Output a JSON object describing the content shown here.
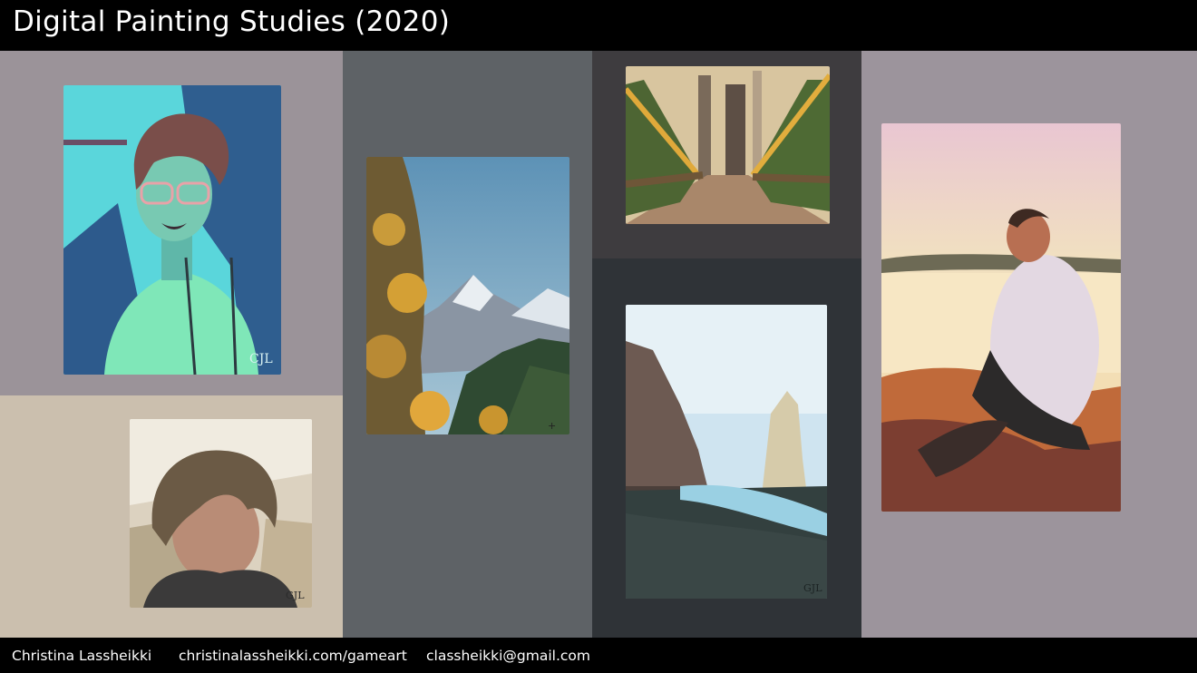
{
  "header": {
    "title": "Digital Painting Studies (2020)"
  },
  "footer": {
    "name": "Christina Lassheikki",
    "website": "christinalassheikki.com/gameart",
    "email": "classheikki@gmail.com"
  },
  "colors": {
    "panel_mauve": "#9b9399",
    "panel_beige": "#cbbfae",
    "panel_slate": "#5e6266",
    "panel_dark_gray": "#3e3c3f",
    "panel_charcoal": "#2f3337",
    "panel_gray_mauve": "#9c949c"
  },
  "paintings": [
    {
      "subject": "self-portrait with glasses"
    },
    {
      "subject": "portrait with messy hair"
    },
    {
      "subject": "autumn mountain landscape"
    },
    {
      "subject": "forest bridge"
    },
    {
      "subject": "sea cliffs and beach"
    },
    {
      "subject": "man sitting at sunset lake"
    }
  ]
}
